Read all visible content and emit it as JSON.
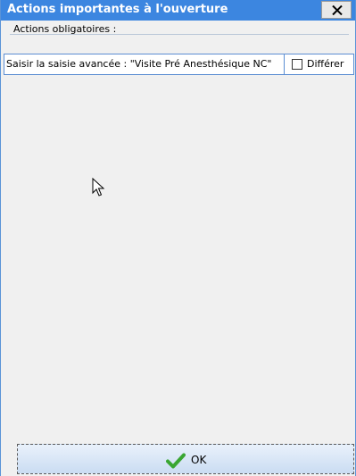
{
  "window": {
    "title": "Actions importantes à l'ouverture",
    "close_icon": "close-icon"
  },
  "mandatory_actions": {
    "group_label": "Actions obligatoires :",
    "items": [
      {
        "description": "Saisir la saisie avancée : \"Visite Pré Anesthésique NC\"",
        "defer_label": "Différer",
        "defer_checked": false
      }
    ]
  },
  "footer": {
    "ok_label": "OK",
    "ok_icon": "checkmark-icon"
  },
  "colors": {
    "titlebar": "#3c86e0",
    "window_bg": "#f0f0f0",
    "row_border": "#5c8ed3",
    "check_green": "#3aa632"
  }
}
